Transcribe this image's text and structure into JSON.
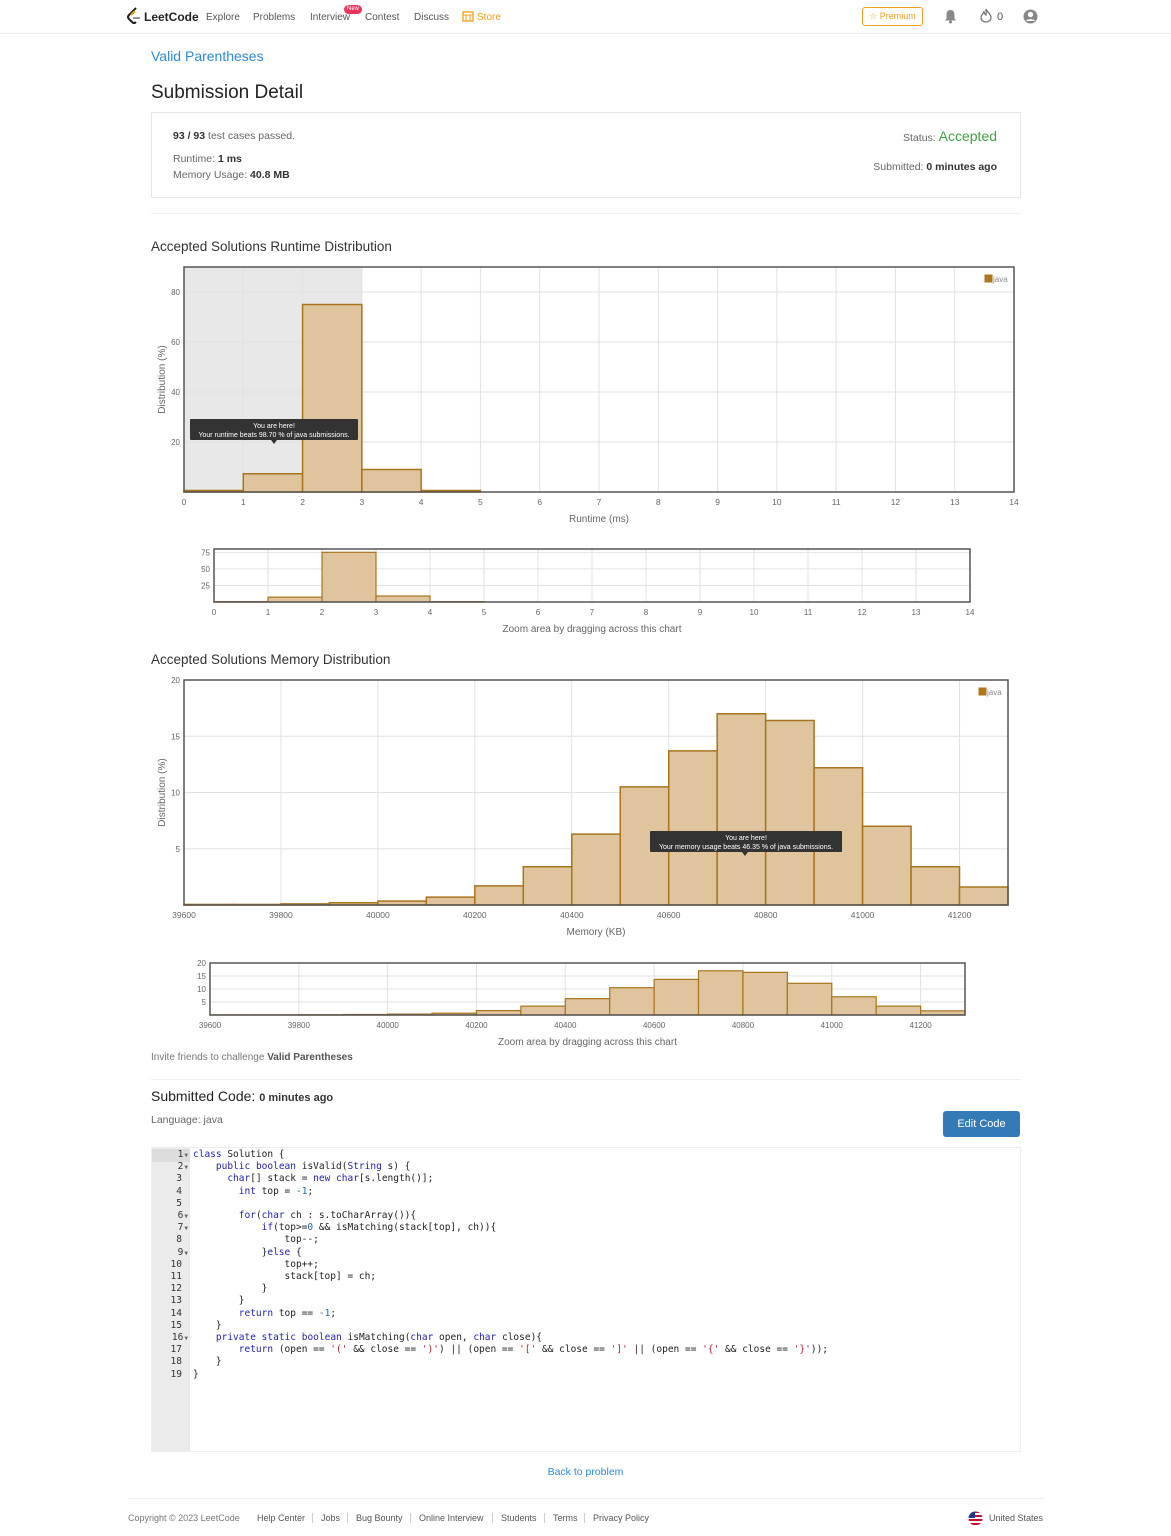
{
  "navbar": {
    "logo_text": "LeetCode",
    "links": [
      "Explore",
      "Problems",
      "Interview",
      "Contest",
      "Discuss",
      "Store"
    ],
    "new_badge": "New",
    "premium_label": "Premium",
    "fire_count": "0",
    "store_color": "#f0a020",
    "premium_color": "#f0a020"
  },
  "problem_title": "Valid Parentheses",
  "page_title": "Submission Detail",
  "result": {
    "cases_passed": "93 / 93",
    "cases_suffix": "test cases passed.",
    "runtime_label": "Runtime:",
    "runtime_value": "1 ms",
    "memory_label": "Memory Usage:",
    "memory_value": "40.8 MB",
    "status_label": "Status:",
    "status_value": "Accepted",
    "status_color": "#43a047",
    "submitted_label": "Submitted:",
    "submitted_value": "0 minutes ago"
  },
  "runtime_section_title": "Accepted Solutions Runtime Distribution",
  "memory_section_title": "Accepted Solutions Memory Distribution",
  "chart_data": [
    {
      "type": "bar",
      "xlabel": "Runtime (ms)",
      "ylabel": "Distribution (%)",
      "xlim": [
        0,
        14
      ],
      "ylim": [
        0,
        90
      ],
      "xticks": [
        "0",
        "1",
        "2",
        "3",
        "4",
        "5",
        "6",
        "7",
        "8",
        "9",
        "10",
        "11",
        "12",
        "13",
        "14"
      ],
      "yticks": [
        "20",
        "40",
        "60",
        "80"
      ],
      "bins": [
        [
          0,
          1
        ],
        [
          1,
          2
        ],
        [
          2,
          3
        ],
        [
          3,
          4
        ],
        [
          4,
          5
        ]
      ],
      "values": [
        0.6,
        7.3,
        75.0,
        9.0,
        0.6
      ],
      "legend": "java",
      "legend_position": "top-right",
      "highlight_range": [
        0,
        3
      ],
      "tooltip_line1": "You are here!",
      "tooltip_line2": "Your runtime beats 98.70 % of java submissions.",
      "zoom_label": "Zoom area by dragging across this chart",
      "zoom_yticks": [
        "25",
        "50",
        "75"
      ],
      "zoom_ylim": [
        0,
        80
      ],
      "bar_fill": "#dfc49e",
      "bar_stroke": "#a8741c",
      "grid": true
    },
    {
      "type": "bar",
      "xlabel": "Memory (KB)",
      "ylabel": "Distribution (%)",
      "xlim": [
        39600,
        41300
      ],
      "ylim": [
        0,
        20
      ],
      "xticks": [
        "39600",
        "39800",
        "40000",
        "40200",
        "40400",
        "40600",
        "40800",
        "41000",
        "41200"
      ],
      "yticks": [
        "5",
        "10",
        "15",
        "20"
      ],
      "bin_width": 100,
      "bin_starts": [
        39600,
        39700,
        39800,
        39900,
        40000,
        40100,
        40200,
        40300,
        40400,
        40500,
        40600,
        40700,
        40800,
        40900,
        41000,
        41100,
        41200,
        41300
      ],
      "values": [
        0.05,
        0.05,
        0.1,
        0.2,
        0.35,
        0.7,
        1.7,
        3.4,
        6.3,
        10.5,
        13.7,
        17.0,
        16.4,
        12.2,
        7.0,
        3.4,
        1.6,
        0.7
      ],
      "legend": "java",
      "legend_position": "top-right",
      "tooltip_line1": "You are here!",
      "tooltip_line2": "Your memory usage beats 46.35 % of java submissions.",
      "zoom_label": "Zoom area by dragging across this chart",
      "zoom_yticks": [
        "5",
        "10",
        "15",
        "20"
      ],
      "zoom_ylim": [
        0,
        20
      ],
      "bar_fill": "#dfc49e",
      "bar_stroke": "#a8741c",
      "grid": true
    }
  ],
  "invite": {
    "prefix": "Invite friends to challenge",
    "problem": "Valid Parentheses"
  },
  "code_section": {
    "title": "Submitted Code:",
    "time": "0 minutes ago",
    "language": "Language: java",
    "edit_button": "Edit Code"
  },
  "code_lines": [
    "class Solution {",
    "    public boolean isValid(String s) {",
    "      char[] stack = new char[s.length()];",
    "        int top = -1;",
    "",
    "        for(char ch : s.toCharArray()){",
    "            if(top>=0 && isMatching(stack[top], ch)){",
    "                top--;",
    "            }else {",
    "                top++;",
    "                stack[top] = ch;",
    "            }",
    "        }",
    "        return top == -1;",
    "    }",
    "    private static boolean isMatching(char open, char close){",
    "        return (open == '(' && close == ')') || (open == '[' && close == ']' || (open == '{' && close == '}'));",
    "    }",
    "}"
  ],
  "fold_lines": [
    1,
    2,
    6,
    7,
    9,
    16
  ],
  "back_link": "Back to problem",
  "footer": {
    "copyright": "Copyright © 2023 LeetCode",
    "links": [
      "Help Center",
      "Jobs",
      "Bug Bounty",
      "Online Interview",
      "Students",
      "Terms",
      "Privacy Policy"
    ],
    "region": "United States"
  }
}
